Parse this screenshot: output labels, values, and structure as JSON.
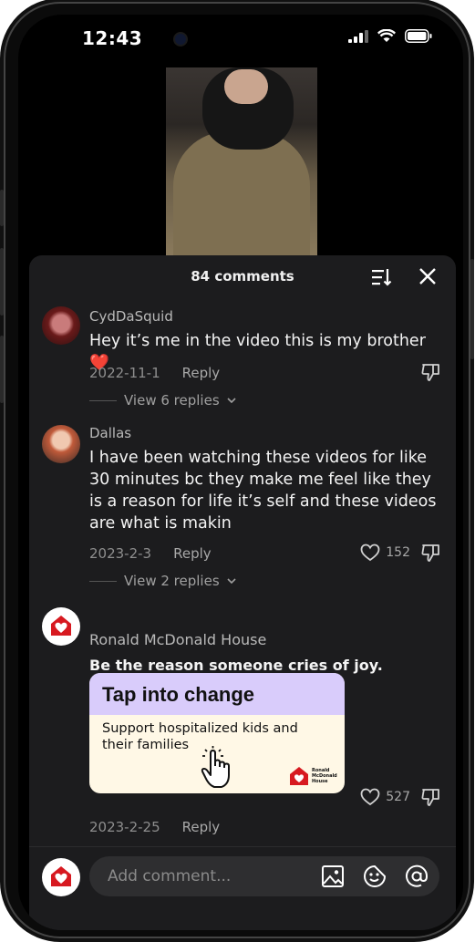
{
  "status": {
    "time": "12:43"
  },
  "comments_panel": {
    "count_label": "84 comments",
    "comments": [
      {
        "username": "CydDaSquid",
        "text": "Hey it’s me in the video this is my brother ❤️",
        "date": "2022-11-1",
        "reply_label": "Reply",
        "view_replies": "View 6 replies"
      },
      {
        "username": "Dallas",
        "text": "I have been watching these videos for like 30 minutes bc they make me feel like they is a reason for life it’s self and these videos are what is makin",
        "date": "2023-2-3",
        "reply_label": "Reply",
        "likes": "152",
        "view_replies": "View 2 replies"
      },
      {
        "username": "Ronald McDonald House",
        "text": "Be the reason someone cries of joy.",
        "date": "2023-2-25",
        "reply_label": "Reply",
        "likes": "527",
        "ad": {
          "title": "Tap into change",
          "subtitle": "Support hospitalized kids and their families",
          "logo_text": "Ronald McDonald House"
        }
      }
    ]
  },
  "input": {
    "placeholder": "Add comment..."
  },
  "colors": {
    "panel_bg": "#1c1c1e",
    "rmh_red": "#d71920",
    "ad_header": "#d9ccfb",
    "ad_body": "#fff8e6"
  }
}
